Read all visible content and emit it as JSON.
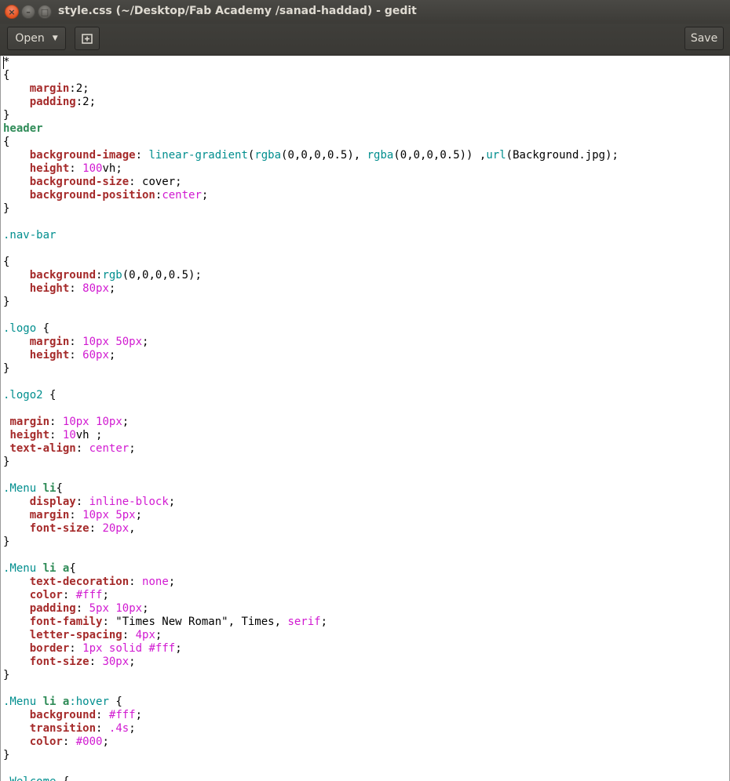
{
  "window": {
    "title": "style.css (~/Desktop/Fab Academy /sanad-haddad) - gedit",
    "close_glyph": "×",
    "minimize_glyph": "–",
    "maximize_glyph": "□"
  },
  "toolbar": {
    "open_label": "Open",
    "open_arrow": "▼",
    "new_tab_icon": "new-tab-icon",
    "save_label": "Save"
  },
  "editor": {
    "file_name": "style.css",
    "lines": [
      "*",
      "{",
      "    margin:2;",
      "    padding:2;",
      "}",
      "header",
      "{",
      "    background-image: linear-gradient(rgba(0,0,0,0.5), rgba(0,0,0,0.5)) ,url(Background.jpg);",
      "    height: 100vh;",
      "    background-size: cover;",
      "    background-position:center;",
      "}",
      "",
      ".nav-bar",
      "",
      "{",
      "    background:rgb(0,0,0,0.5);",
      "    height: 80px;",
      "}",
      "",
      ".logo {",
      "    margin: 10px 50px;",
      "    height: 60px;",
      "}",
      "",
      ".logo2 {",
      "",
      " margin: 10px 10px;",
      " height: 10vh ;",
      " text-align: center;",
      "}",
      "",
      ".Menu li{",
      "    display: inline-block;",
      "    margin: 10px 5px;",
      "    font-size: 20px,",
      "}",
      "",
      ".Menu li a{",
      "    text-decoration: none;",
      "    color: #fff;",
      "    padding: 5px 10px;",
      "    font-family: \"Times New Roman\", Times, serif;",
      "    letter-spacing: 4px;",
      "    border: 1px solid #fff;",
      "    font-size: 30px;",
      "}",
      "",
      ".Menu li a:hover {",
      "    background: #fff;",
      "    transition: .4s;",
      "    color: #000;",
      "}",
      "",
      ".Welcome {"
    ]
  }
}
